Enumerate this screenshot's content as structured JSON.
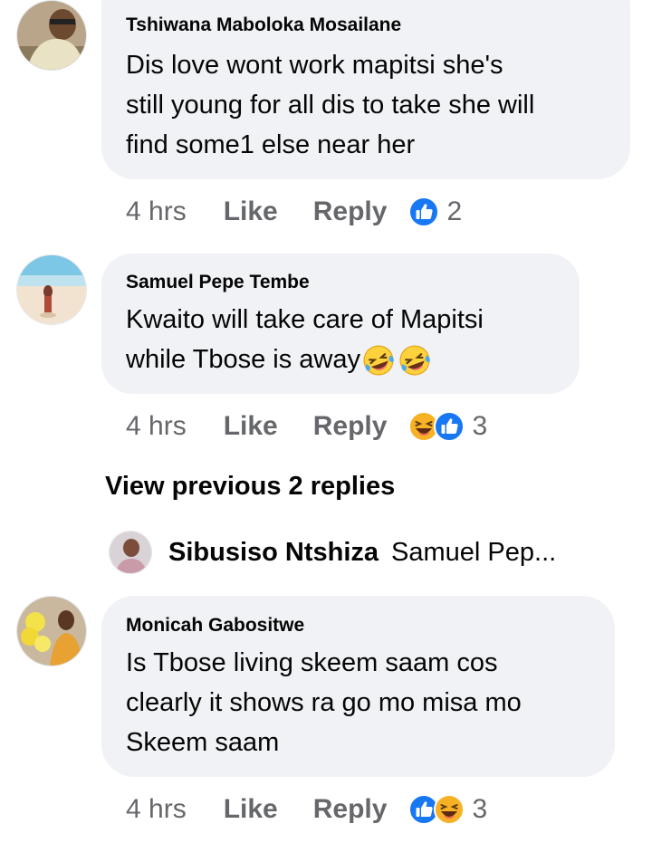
{
  "comments": [
    {
      "author": "Tshiwana Maboloka Mosailane",
      "lines": [
        "Dis love wont work mapitsi she's",
        "still young for all dis to take she will",
        "find some1 else near her"
      ],
      "time": "4 hrs",
      "like_label": "Like",
      "reply_label": "Reply",
      "reactions": [
        "like"
      ],
      "reaction_count": "2"
    },
    {
      "author": "Samuel Pepe Tembe",
      "lines": [
        " Kwaito will take care of Mapitsi",
        "while Tbose is away"
      ],
      "trailing_emoji": [
        "laughing-tears",
        "laughing-tears"
      ],
      "time": "4 hrs",
      "like_label": "Like",
      "reply_label": "Reply",
      "reactions": [
        "haha",
        "like"
      ],
      "reaction_count": "3"
    },
    {
      "author": "Monicah Gabositwe",
      "lines": [
        "Is Tbose living skeem saam cos",
        "clearly it shows ra go mo misa mo",
        "Skeem saam"
      ],
      "time": "4 hrs",
      "like_label": "Like",
      "reply_label": "Reply",
      "reactions": [
        "like",
        "haha"
      ],
      "reaction_count": "3"
    }
  ],
  "view_previous": "View previous 2 replies",
  "reply_preview": {
    "name": "Sibusiso Ntshiza",
    "text": "Samuel Pep..."
  },
  "colors": {
    "bubble": "#f0f2f5",
    "meta": "#65676b",
    "like_blue": "#1877f2",
    "haha_yellow": "#f7b125"
  }
}
